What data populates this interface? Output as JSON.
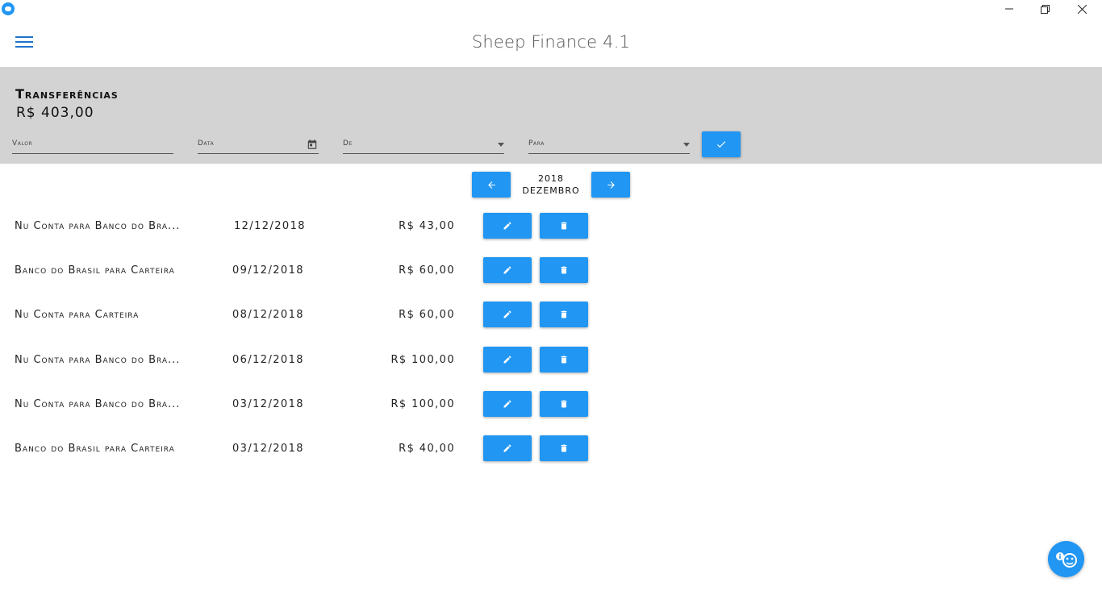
{
  "window": {
    "title": "Sheep Finance 4.1"
  },
  "panel": {
    "title": "Transferências",
    "total": "R$ 403,00",
    "fields": {
      "valor_label": "Valor",
      "data_label": "Data",
      "de_label": "De",
      "para_label": "Para"
    }
  },
  "period": {
    "year": "2018",
    "month": "DEZEMBRO"
  },
  "transfers": [
    {
      "description": "Nu Conta para Banco do Bra...",
      "date": "12/12/2018",
      "amount": "R$ 43,00"
    },
    {
      "description": "Banco do Brasil para Carteira",
      "date": "09/12/2018",
      "amount": "R$ 60,00"
    },
    {
      "description": "Nu Conta para Carteira",
      "date": "08/12/2018",
      "amount": "R$ 60,00"
    },
    {
      "description": "Nu Conta para Banco do Bra...",
      "date": "06/12/2018",
      "amount": "R$ 100,00"
    },
    {
      "description": "Nu Conta para Banco do Bra...",
      "date": "03/12/2018",
      "amount": "R$ 100,00"
    },
    {
      "description": "Banco do Brasil para Carteira",
      "date": "03/12/2018",
      "amount": "R$ 40,00"
    }
  ],
  "icons": {
    "menu": "menu-icon",
    "calendar": "calendar-icon",
    "confirm": "check-icon",
    "prev": "arrow-left-icon",
    "next": "arrow-right-icon",
    "edit": "pencil-icon",
    "delete": "trash-icon",
    "fab": "sheep-info-icon"
  },
  "colors": {
    "accent": "#2196f3",
    "panel": "#d3d3d3",
    "menu": "#1e74c8"
  }
}
